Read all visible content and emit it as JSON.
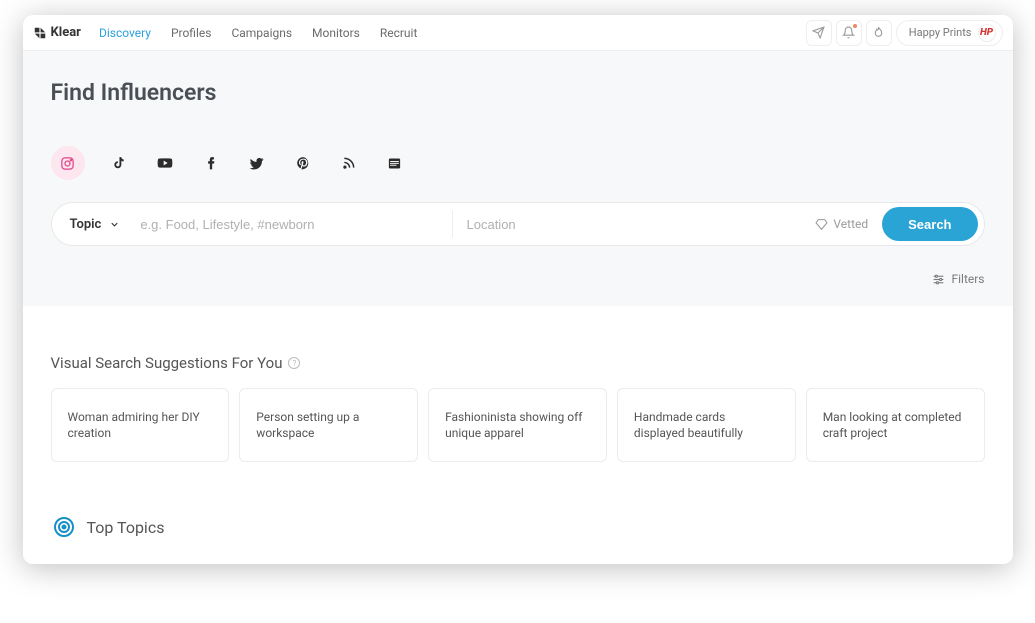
{
  "brand": "Klear",
  "nav": {
    "items": [
      "Discovery",
      "Profiles",
      "Campaigns",
      "Monitors",
      "Recruit"
    ],
    "active_index": 0
  },
  "account": {
    "name": "Happy Prints",
    "initials": "HP"
  },
  "hero": {
    "title": "Find Influencers",
    "platforms": [
      "instagram",
      "tiktok",
      "youtube",
      "facebook",
      "twitter",
      "pinterest",
      "rss",
      "website"
    ],
    "selected_platform_index": 0,
    "topic_dropdown_label": "Topic",
    "topic_placeholder": "e.g. Food, Lifestyle, #newborn",
    "location_placeholder": "Location",
    "vetted_label": "Vetted",
    "search_button_label": "Search",
    "filters_label": "Filters"
  },
  "suggestions": {
    "heading": "Visual Search Suggestions For You",
    "cards": [
      "Woman admiring her DIY creation",
      "Person setting up a workspace",
      "Fashioninista showing off unique apparel",
      "Handmade cards displayed beautifully",
      "Man looking at completed craft project"
    ]
  },
  "top_topics": {
    "label": "Top Topics"
  }
}
